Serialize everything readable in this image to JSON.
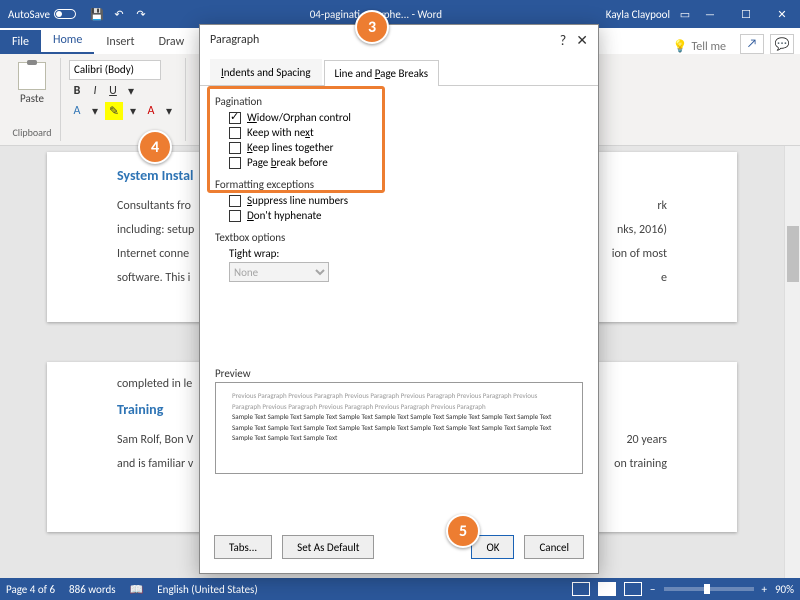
{
  "titlebar": {
    "autosave_label": "AutoSave",
    "autosave_state": "Off",
    "doc_title": "04-paginati... ...yphe... - Word",
    "user_name": "Kayla Claypool"
  },
  "ribbon_tabs": {
    "file": "File",
    "home": "Home",
    "insert": "Insert",
    "draw": "Draw",
    "tellme": "Tell me"
  },
  "ribbon": {
    "paste_label": "Paste",
    "clipboard_label": "Clipboard",
    "font_name": "Calibri (Body)"
  },
  "document": {
    "h1": "System Instal",
    "p1": "Consultants fro",
    "p1b": "rk",
    "p2": "including: setup",
    "p2b": "nks, 2016)",
    "p3": "Internet conne",
    "p3b": "ion of most",
    "p4": "software. This i",
    "p4b": "e",
    "p5": "completed in le",
    "h2": "Training",
    "p6": "Sam Rolf, Bon V",
    "p6b": "20 years",
    "p7": "and is familiar v",
    "p7b": "on training"
  },
  "dialog": {
    "title": "Paragraph",
    "tab1": "Indents and Spacing",
    "tab2": "Line and Page Breaks",
    "group_pagination": "Pagination",
    "opt_widow": "Widow/Orphan control",
    "opt_keepnext": "Keep with next",
    "opt_keeplines": "Keep lines together",
    "opt_pagebreak": "Page break before",
    "group_format": "Formatting exceptions",
    "opt_suppress": "Suppress line numbers",
    "opt_hyphen": "Don't hyphenate",
    "group_textbox": "Textbox options",
    "tightwrap_label": "Tight wrap:",
    "tightwrap_value": "None",
    "preview_label": "Preview",
    "preview_prev": "Previous Paragraph Previous Paragraph Previous Paragraph Previous Paragraph Previous Paragraph Previous Paragraph Previous Paragraph Previous Paragraph Previous Paragraph Previous Paragraph",
    "preview_sample": "Sample Text Sample Text Sample Text Sample Text Sample Text Sample Text Sample Text Sample Text Sample Text Sample Text Sample Text Sample Text Sample Text Sample Text Sample Text Sample Text Sample Text Sample Text Sample Text Sample Text Sample Text",
    "btn_tabs": "Tabs...",
    "btn_default": "Set As Default",
    "btn_ok": "OK",
    "btn_cancel": "Cancel"
  },
  "statusbar": {
    "page": "Page 4 of 6",
    "words": "886 words",
    "lang": "English (United States)",
    "zoom": "90%"
  },
  "callouts": {
    "c3": "3",
    "c4": "4",
    "c5": "5"
  }
}
